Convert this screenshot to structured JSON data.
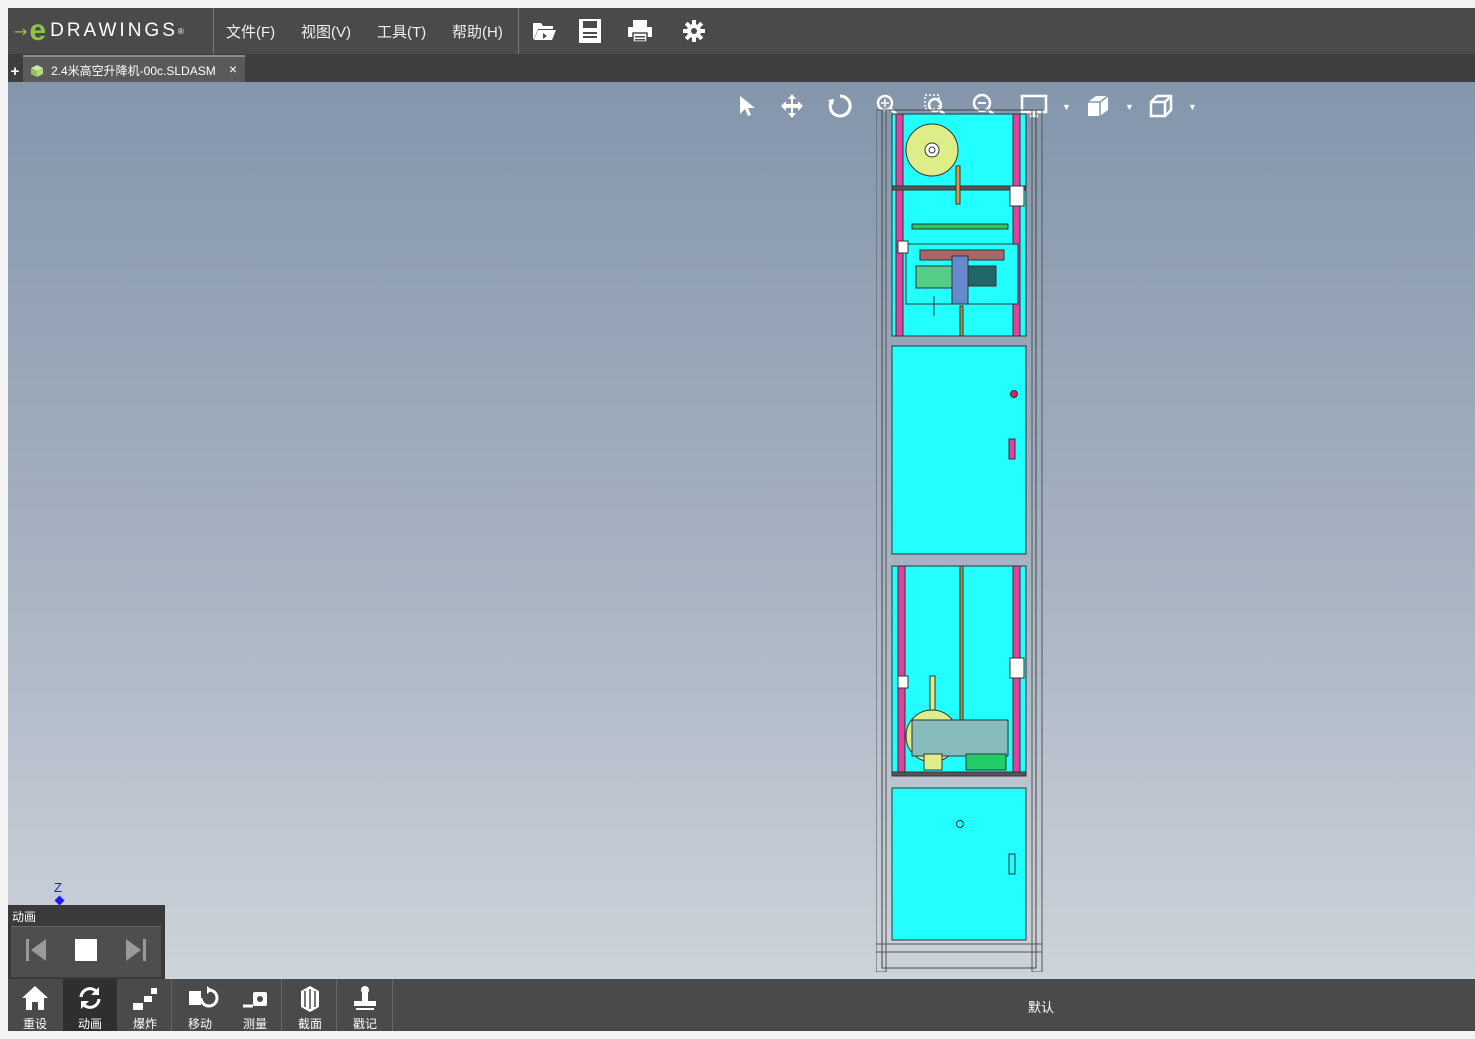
{
  "app": {
    "logo_arrow": "→",
    "logo_e": "e",
    "logo_word": "DRAWINGS",
    "logo_mark": "®"
  },
  "menu": {
    "file": "文件(F)",
    "view": "视图(V)",
    "tools": "工具(T)",
    "help": "帮助(H)"
  },
  "toolbar": {
    "open_icon": "folder-open-icon",
    "save_icon": "save-icon",
    "print_icon": "print-icon",
    "settings_icon": "gear-icon"
  },
  "tabs": {
    "new_label": "+",
    "document": {
      "label": "2.4米高空升降机-00c.SLDASM",
      "close": "×"
    }
  },
  "view_tools": [
    "select-arrow-icon",
    "pan-icon",
    "rotate-icon",
    "zoom-fit-icon",
    "zoom-area-icon",
    "zoom-in-out-icon",
    "display-style-icon",
    "section-view-icon",
    "view-orientation-icon"
  ],
  "axis": {
    "z_label": "Z"
  },
  "animation_panel": {
    "title": "动画",
    "buttons": [
      "skip-start-icon",
      "stop-icon",
      "skip-end-icon"
    ]
  },
  "bottom_tools": [
    {
      "label": "重设",
      "icon": "home-icon"
    },
    {
      "label": "动画",
      "icon": "animate-icon"
    },
    {
      "label": "爆炸",
      "icon": "explode-icon"
    },
    {
      "label": "移动",
      "icon": "move-icon"
    },
    {
      "label": "测量",
      "icon": "measure-icon"
    },
    {
      "label": "截面",
      "icon": "section-icon"
    },
    {
      "label": "戳记",
      "icon": "stamp-icon"
    }
  ],
  "status": {
    "configuration": "默认"
  },
  "colors": {
    "accent": "#8bc34a",
    "model_fill": "#22ffff",
    "model_rail": "#e040a0",
    "model_motor": "#ddee88"
  }
}
